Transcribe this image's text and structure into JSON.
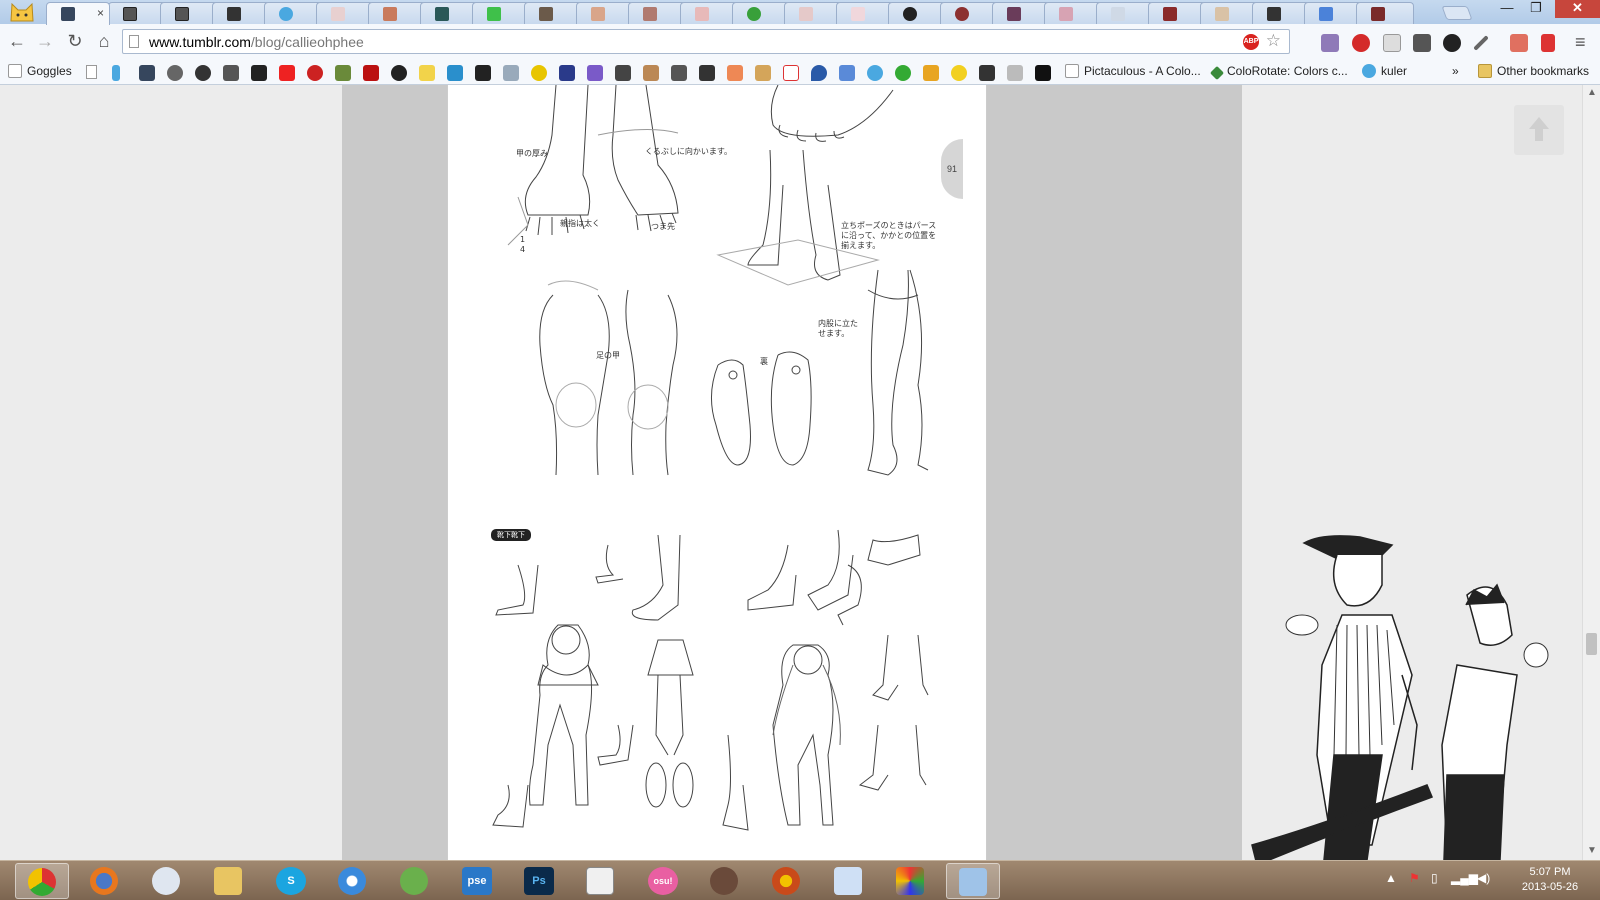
{
  "browser": {
    "active_tab_favicon": "tumblr-icon",
    "active_tab_close": "×",
    "window_controls": {
      "minimize": "—",
      "maximize": "❐",
      "close": "✕"
    }
  },
  "toolbar": {
    "back": "←",
    "forward": "→",
    "reload": "↻",
    "home": "⌂",
    "url_domain": "www.tumblr.com",
    "url_path": "/blog/callieohphee",
    "abp_badge": "ABP",
    "star": "☆",
    "menu": "≡"
  },
  "bookmarks": {
    "goggles": "Goggles",
    "pictaculous": "Pictaculous - A Colo...",
    "colorotate": "ColoRotate: Colors c...",
    "kuler": "kuler",
    "overflow": "»",
    "other": "Other bookmarks"
  },
  "art": {
    "page_number": "91",
    "section_label": "靴下靴下",
    "notes": {
      "instep_thickness": "甲の厚み",
      "toward_ankle": "くるぶしに向かいます。",
      "big_toe": "親指は太く",
      "toe_tip": "つま先",
      "fraction": "1\n4",
      "standing_pose": "立ちポーズのときはパース\nに沿って、かかとの位置を\n揃えます。",
      "instep": "足の甲",
      "sole": "裏",
      "inner_leg": "内股に立た\nせます。"
    }
  },
  "scrollbar": {
    "up": "▲",
    "down": "▼"
  },
  "taskbar": {
    "clock_time": "5:07 PM",
    "clock_date": "2013-05-26",
    "pse_label": "pse",
    "ps_label": "Ps",
    "osu_label": "osu!",
    "skype_label": "S"
  }
}
